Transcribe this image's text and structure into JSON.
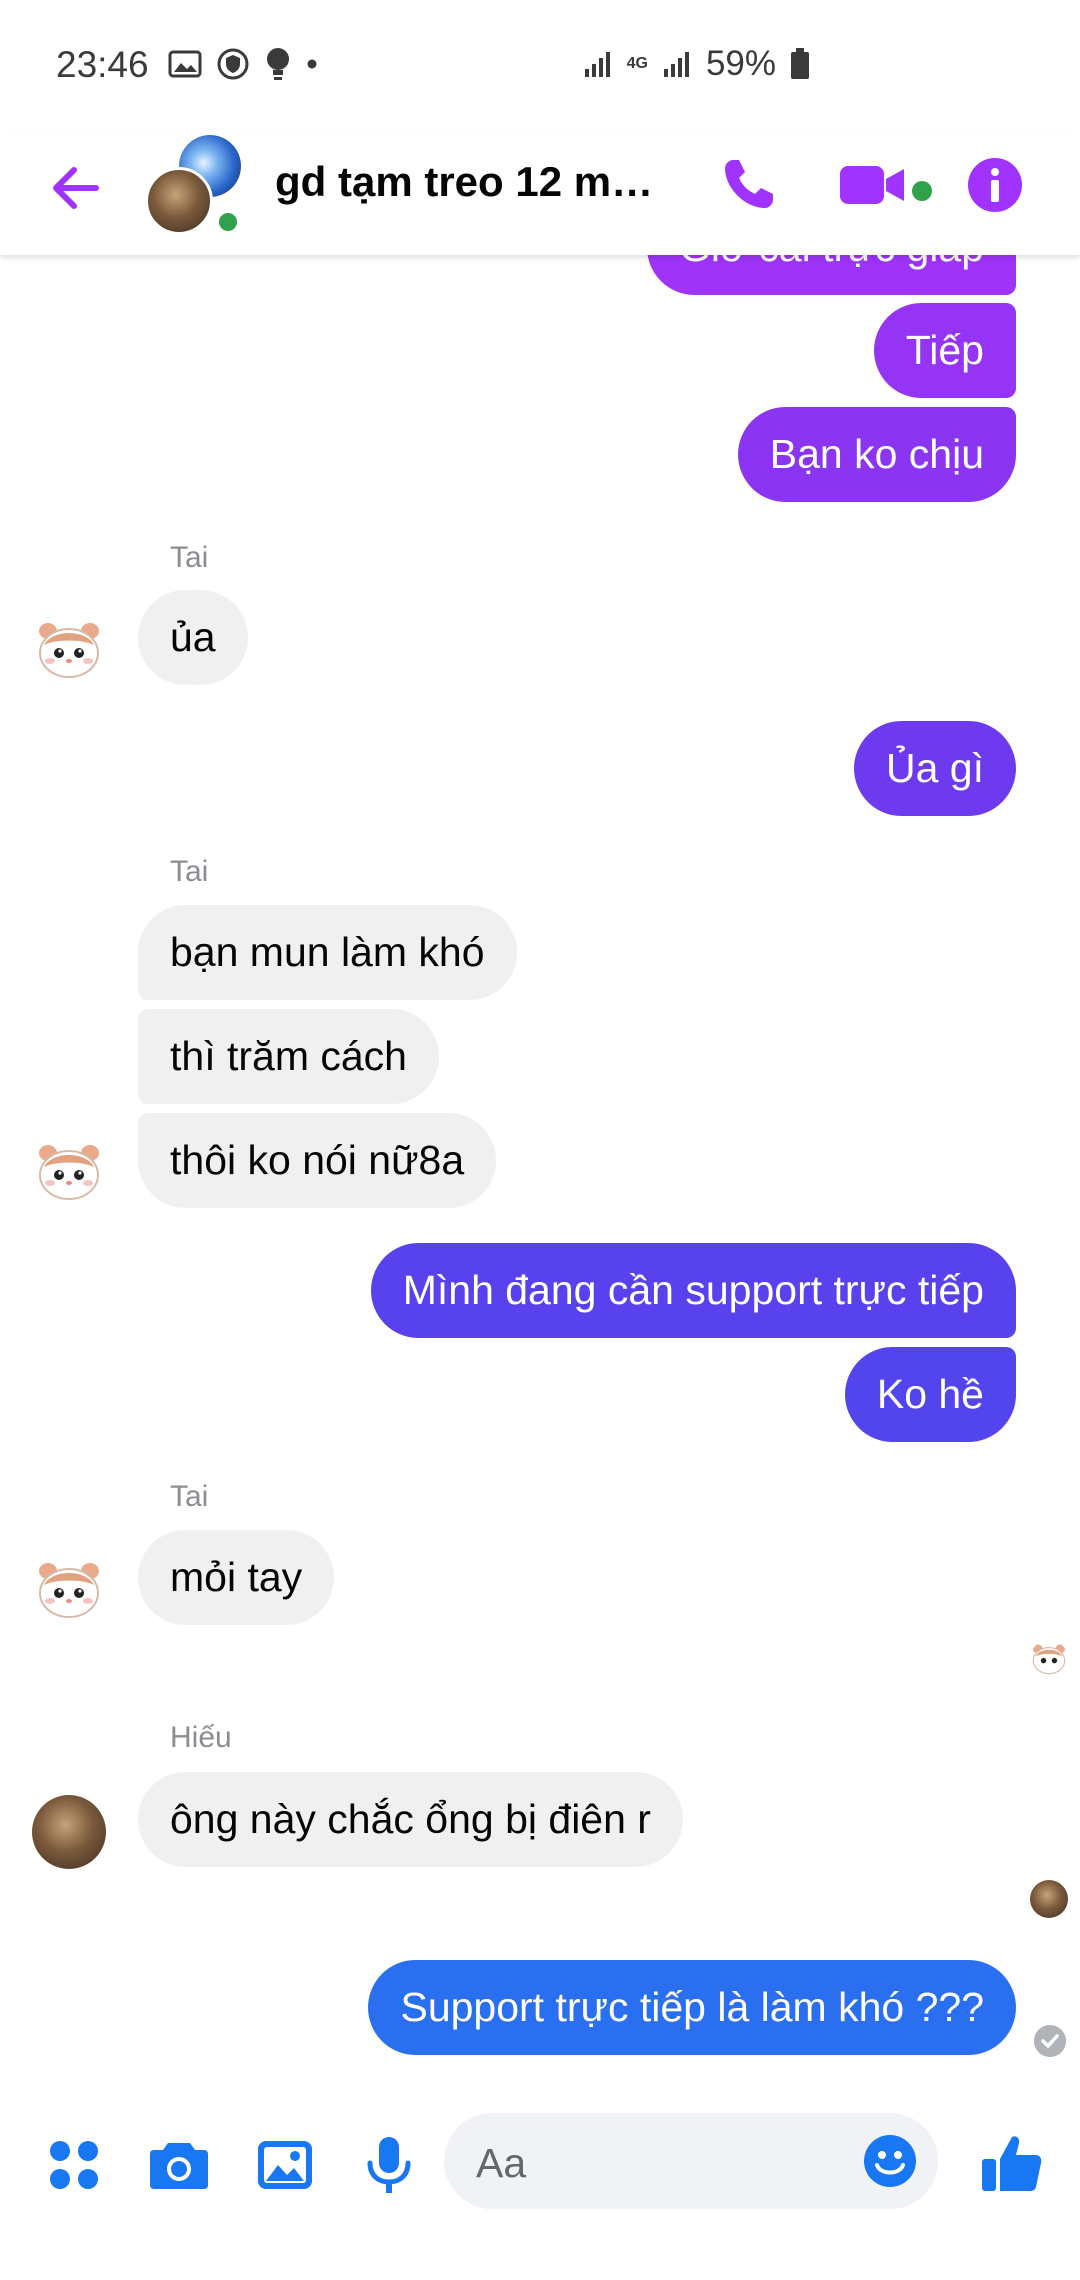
{
  "status_bar": {
    "time": "23:46",
    "network": "4G",
    "battery": "59%"
  },
  "header": {
    "title": "gd tạm treo 12 m…"
  },
  "colors": {
    "accent": "#a033ff",
    "accent_blue": "#1877f2",
    "online": "#31a24c"
  },
  "messages": [
    {
      "type": "out",
      "text": "Giờ cái trực giấp",
      "color": "#9f34f8"
    },
    {
      "type": "out",
      "text": "Tiếp",
      "color": "#9534f5"
    },
    {
      "type": "out",
      "text": "Bạn ko chịu",
      "color": "#8b35f3"
    },
    {
      "type": "sender",
      "text": "Tai"
    },
    {
      "type": "in",
      "text": "ủa"
    },
    {
      "type": "out",
      "text": "Ủa gì",
      "color": "#6e3af0"
    },
    {
      "type": "sender",
      "text": "Tai"
    },
    {
      "type": "in",
      "text": "bạn mun làm khó"
    },
    {
      "type": "in",
      "text": "thì trăm cách"
    },
    {
      "type": "in",
      "text": "thôi ko nói nữ8a"
    },
    {
      "type": "out",
      "text": "Mình đang cần support trực tiếp",
      "color": "#5842ee"
    },
    {
      "type": "out",
      "text": "Ko hề",
      "color": "#5245ee"
    },
    {
      "type": "sender",
      "text": "Tai"
    },
    {
      "type": "in",
      "text": "mỏi tay"
    },
    {
      "type": "sender",
      "text": "Hiếu"
    },
    {
      "type": "in",
      "text": "ông này chắc ổng bị điên r"
    },
    {
      "type": "out",
      "text": "Support trực tiếp là làm khó ???",
      "color": "#2a6ff0"
    }
  ],
  "composer": {
    "placeholder": "Aa"
  },
  "icons": {
    "header": [
      "back-arrow-icon",
      "phone-icon",
      "video-camera-icon",
      "info-icon"
    ],
    "composer": [
      "menu-grid-icon",
      "camera-icon",
      "gallery-icon",
      "microphone-icon",
      "emoji-icon",
      "thumbs-up-icon"
    ]
  }
}
